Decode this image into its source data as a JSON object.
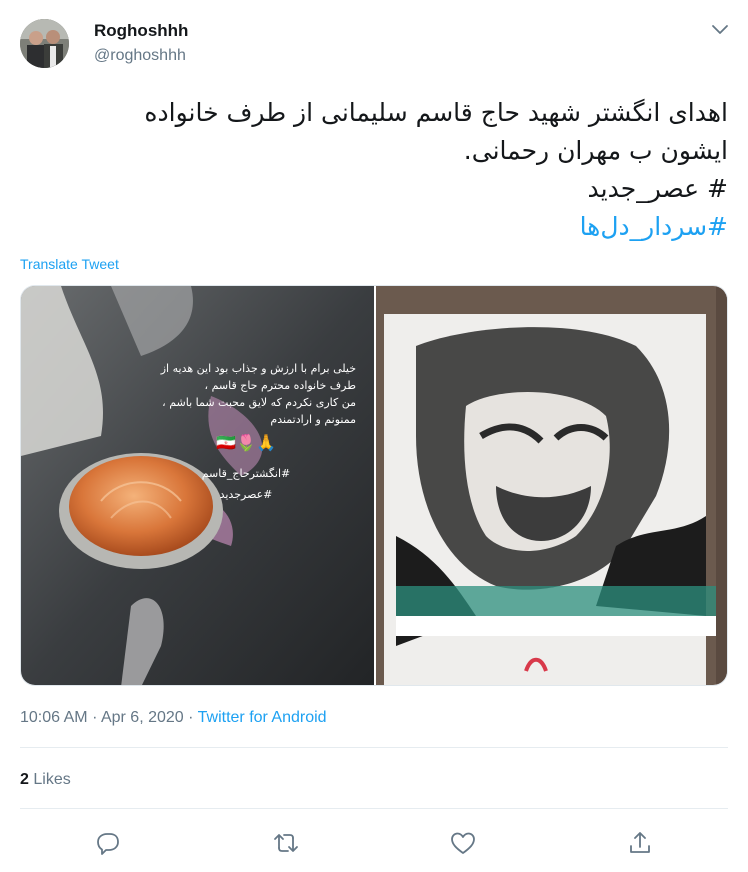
{
  "user": {
    "display_name": "Roghoshhh",
    "handle": "@roghoshhh"
  },
  "tweet": {
    "lines": [
      "اهدای انگشتر شهید حاج قاسم سلیمانی از طرف خانواده",
      "ایشون ب مهران رحمانی."
    ],
    "hashtag_plain": "# عصر_جدید",
    "hashtag_link": "#سردار_دل‌ها"
  },
  "translate_label": "Translate Tweet",
  "media": {
    "left_caption": {
      "lines": [
        "خیلی برام با ارزش و جذاب بود این هدیه از",
        "طرف خانواده محترم حاج قاسم ،",
        "من کاری نکردم که لایق محبت شما باشم ،",
        "ممنونم و ارادتمندم"
      ],
      "emoji": "🙏🌷🇮🇷",
      "tags": [
        "#انگشترحاج_قاسم",
        "#عصرجدید"
      ]
    }
  },
  "meta": {
    "time": "10:06 AM",
    "separator": "·",
    "date": "Apr 6, 2020",
    "source": "Twitter for Android"
  },
  "likes": {
    "count": "2",
    "label": "Likes"
  },
  "colors": {
    "accent": "#1da1f2",
    "secondary_text": "#657786",
    "divider": "#e6ecf0"
  },
  "icons": [
    "reply-icon",
    "retweet-icon",
    "like-icon",
    "share-icon",
    "chevron-down-icon"
  ]
}
